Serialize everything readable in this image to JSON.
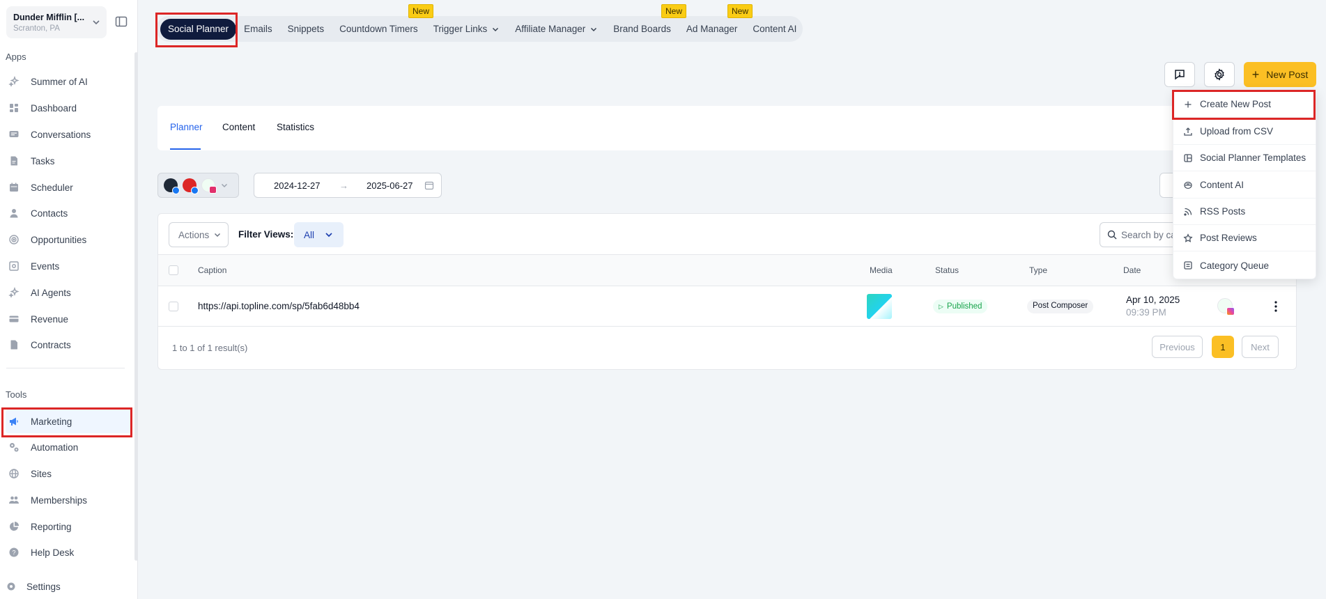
{
  "account": {
    "name": "Dunder Mifflin [...",
    "location": "Scranton, PA"
  },
  "sidebar": {
    "apps_label": "Apps",
    "apps": [
      {
        "label": "Summer of AI",
        "icon": "sparkle-icon"
      },
      {
        "label": "Dashboard",
        "icon": "dashboard-icon"
      },
      {
        "label": "Conversations",
        "icon": "chat-icon"
      },
      {
        "label": "Tasks",
        "icon": "task-icon"
      },
      {
        "label": "Scheduler",
        "icon": "calendar-icon"
      },
      {
        "label": "Contacts",
        "icon": "person-icon"
      },
      {
        "label": "Opportunities",
        "icon": "target-icon"
      },
      {
        "label": "Events",
        "icon": "event-icon"
      },
      {
        "label": "AI Agents",
        "icon": "sparkle-icon"
      },
      {
        "label": "Revenue",
        "icon": "card-icon"
      },
      {
        "label": "Contracts",
        "icon": "document-icon"
      }
    ],
    "tools_label": "Tools",
    "tools": [
      {
        "label": "Marketing",
        "icon": "megaphone-icon"
      },
      {
        "label": "Automation",
        "icon": "gears-icon"
      },
      {
        "label": "Sites",
        "icon": "globe-icon"
      },
      {
        "label": "Memberships",
        "icon": "users-icon"
      },
      {
        "label": "Reporting",
        "icon": "pie-chart-icon"
      },
      {
        "label": "Help Desk",
        "icon": "help-icon"
      }
    ],
    "settings_label": "Settings"
  },
  "topnav": {
    "tabs": [
      {
        "label": "Social Planner",
        "active": true
      },
      {
        "label": "Emails"
      },
      {
        "label": "Snippets"
      },
      {
        "label": "Countdown Timers",
        "badge": "New"
      },
      {
        "label": "Trigger Links",
        "dropdown": true
      },
      {
        "label": "Affiliate Manager",
        "dropdown": true
      },
      {
        "label": "Brand Boards",
        "badge": "New"
      },
      {
        "label": "Ad Manager",
        "badge": "New"
      },
      {
        "label": "Content AI"
      }
    ]
  },
  "toolbar": {
    "new_post_label": "New Post"
  },
  "subtabs": [
    "Planner",
    "Content",
    "Statistics"
  ],
  "filters": {
    "date_start": "2024-12-27",
    "date_end": "2025-06-27"
  },
  "table": {
    "actions_label": "Actions",
    "filter_views_label": "Filter Views:",
    "filter_views_value": "All",
    "search_placeholder": "Search by caption",
    "columns": [
      "Caption",
      "Media",
      "Status",
      "Type",
      "Date"
    ],
    "rows": [
      {
        "caption": "https://api.topline.com/sp/5fab6d48bb4",
        "status": "Published",
        "type": "Post Composer",
        "date": "Apr 10, 2025",
        "time": "09:39 PM"
      }
    ],
    "result_count": "1 to 1 of 1 result(s)",
    "pagination": {
      "previous": "Previous",
      "page": "1",
      "next": "Next"
    }
  },
  "menu": {
    "items": [
      {
        "label": "Create New Post",
        "icon": "plus-icon"
      },
      {
        "label": "Upload from CSV",
        "icon": "upload-icon"
      },
      {
        "label": "Social Planner Templates",
        "icon": "template-icon"
      },
      {
        "label": "Content AI",
        "icon": "ai-brain-icon"
      },
      {
        "label": "RSS Posts",
        "icon": "rss-icon"
      },
      {
        "label": "Post Reviews",
        "icon": "star-icon"
      },
      {
        "label": "Category Queue",
        "icon": "queue-icon"
      }
    ]
  },
  "colors": {
    "accent": "#fbbf24",
    "nav_active": "#0f1b3d",
    "highlight": "#dc2626",
    "link": "#2563eb"
  }
}
